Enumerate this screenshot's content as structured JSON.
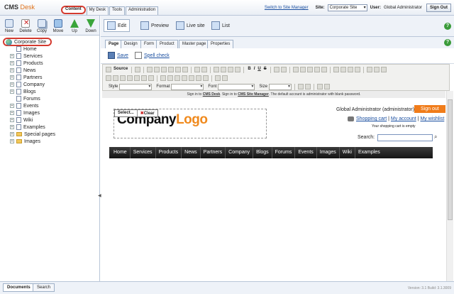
{
  "header": {
    "brand_cms": "CMS",
    "brand_desk": "Desk",
    "tabs": [
      "Content",
      "My Desk",
      "Tools",
      "Administration"
    ],
    "switch_link": "Switch to Site Manager",
    "site_label": "Site:",
    "site_value": "Corporate Site",
    "user_label": "User:",
    "user_value": "Global Administrator",
    "signout": "Sign Out"
  },
  "left_toolbar": [
    "New",
    "Delete",
    "Copy",
    "Move",
    "Up",
    "Down"
  ],
  "tree": {
    "root": "Corporate Site",
    "items": [
      {
        "label": "Home",
        "expand": false,
        "type": "doc"
      },
      {
        "label": "Services",
        "expand": true,
        "type": "doc"
      },
      {
        "label": "Products",
        "expand": true,
        "type": "doc"
      },
      {
        "label": "News",
        "expand": true,
        "type": "doc"
      },
      {
        "label": "Partners",
        "expand": true,
        "type": "doc"
      },
      {
        "label": "Company",
        "expand": true,
        "type": "doc"
      },
      {
        "label": "Blogs",
        "expand": true,
        "type": "doc"
      },
      {
        "label": "Forums",
        "expand": false,
        "type": "doc"
      },
      {
        "label": "Events",
        "expand": true,
        "type": "doc"
      },
      {
        "label": "Images",
        "expand": true,
        "type": "doc"
      },
      {
        "label": "Wiki",
        "expand": true,
        "type": "doc"
      },
      {
        "label": "Examples",
        "expand": true,
        "type": "doc"
      },
      {
        "label": "Special pages",
        "expand": true,
        "type": "folder"
      },
      {
        "label": "Images",
        "expand": true,
        "type": "folder"
      }
    ]
  },
  "bottom": {
    "tabs": [
      "Documents",
      "Search"
    ],
    "version": "Version: 3.1 Build: 3.1.3009"
  },
  "modes": [
    "Edit",
    "Preview",
    "Live site",
    "List"
  ],
  "subtabs": [
    "Page",
    "Design",
    "Form",
    "Product",
    "Master page",
    "Properties"
  ],
  "savebar": {
    "save": "Save",
    "spell": "Spell check"
  },
  "editor_toolbar": {
    "source": "Source",
    "style_label": "Style",
    "format_label": "Format",
    "font_label": "Font",
    "size_label": "Size",
    "bold": "B",
    "italic": "I",
    "underline": "U",
    "strike": "S"
  },
  "preview": {
    "notice_pre": "Sign in to",
    "notice_cms": "CMS Desk",
    "notice_mid": ". Sign in to",
    "notice_sm": "CMS Site Manager",
    "notice_post": ". The default account is administrator with blank password.",
    "logo_select": "Select...",
    "logo_clear": "Clear",
    "logo_company": "Company",
    "logo_logo": "Logo",
    "admin_name": "Global Administrator (administrator)",
    "signout": "Sign out",
    "shopping_cart": "Shopping cart",
    "my_account": "My account",
    "my_wishlist": "My wishlist",
    "cart_empty": "Your shopping cart is empty",
    "search_label": "Search:",
    "nav": [
      "Home",
      "Services",
      "Products",
      "News",
      "Partners",
      "Company",
      "Blogs",
      "Forums",
      "Events",
      "Images",
      "Wiki",
      "Examples"
    ]
  }
}
